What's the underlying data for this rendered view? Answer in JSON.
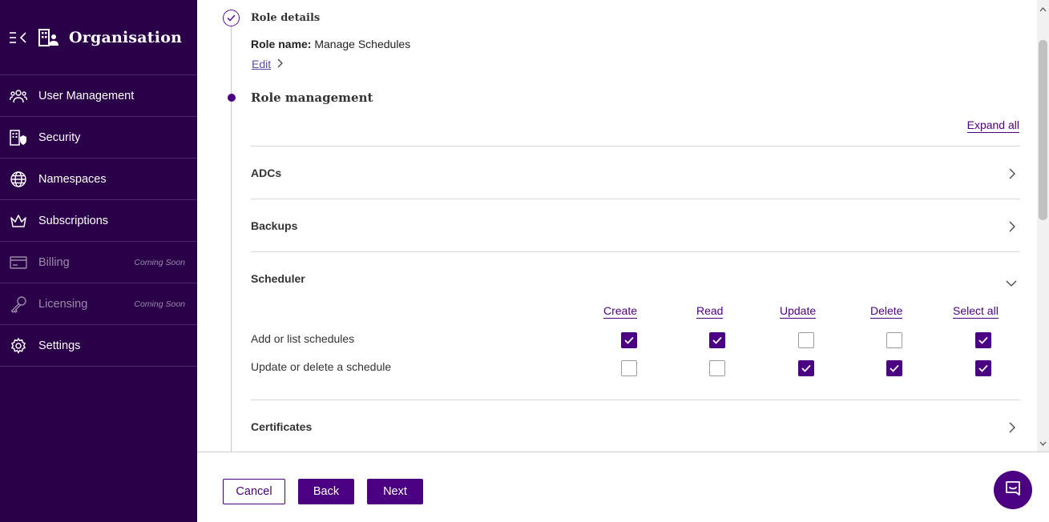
{
  "sidebar": {
    "title": "Organisation",
    "items": [
      {
        "label": "User Management",
        "icon": "users-icon"
      },
      {
        "label": "Security",
        "icon": "security-building-icon"
      },
      {
        "label": "Namespaces",
        "icon": "globe-icon"
      },
      {
        "label": "Subscriptions",
        "icon": "crown-icon"
      },
      {
        "label": "Billing",
        "icon": "credit-card-icon",
        "badge": "Coming Soon"
      },
      {
        "label": "Licensing",
        "icon": "key-icon",
        "badge": "Coming Soon"
      },
      {
        "label": "Settings",
        "icon": "gear-icon"
      }
    ]
  },
  "steps": {
    "details_title": "Role details",
    "role_name_label": "Role name:",
    "role_name_value": "Manage Schedules",
    "edit_label": "Edit",
    "management_title": "Role management",
    "expand_all": "Expand all"
  },
  "sections": [
    {
      "title": "ADCs",
      "expanded": false
    },
    {
      "title": "Backups",
      "expanded": false
    },
    {
      "title": "Scheduler",
      "expanded": true
    },
    {
      "title": "Certificates",
      "expanded": false
    }
  ],
  "scheduler": {
    "columns": [
      "Create",
      "Read",
      "Update",
      "Delete",
      "Select all"
    ],
    "rows": [
      {
        "label": "Add or list schedules",
        "checks": [
          true,
          true,
          false,
          false,
          true
        ]
      },
      {
        "label": "Update or delete a schedule",
        "checks": [
          false,
          false,
          true,
          true,
          true
        ]
      }
    ]
  },
  "footer": {
    "cancel": "Cancel",
    "back": "Back",
    "next": "Next"
  },
  "colors": {
    "sidebar_bg": "#2a0048",
    "accent": "#4b0082",
    "link": "#5a4ab0"
  }
}
